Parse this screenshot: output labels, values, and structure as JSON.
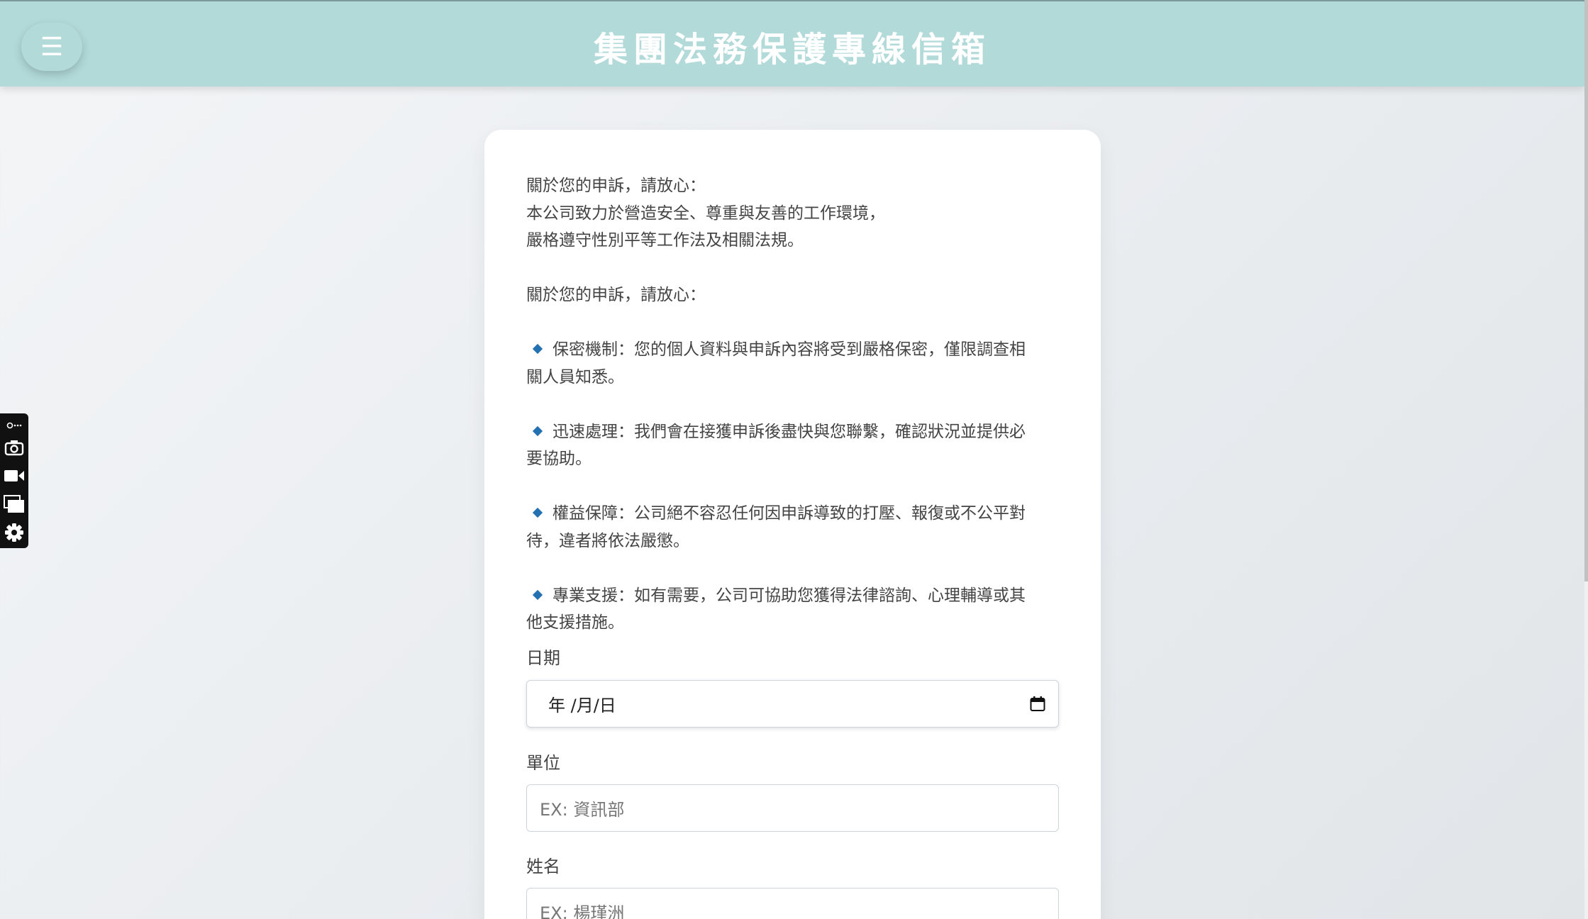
{
  "header": {
    "title": "集團法務保護專線信箱",
    "menu_icon": "☰"
  },
  "notice": {
    "intro_line1": "關於您的申訴，請放心：",
    "intro_line2": "本公司致力於營造安全、尊重與友善的工作環境，",
    "intro_line3": "嚴格遵守性別平等工作法及相關法規。",
    "heading": "關於您的申訴，請放心：",
    "bullets": [
      {
        "line1": "保密機制：您的個人資料與申訴內容將受到嚴格保密，僅限調查相",
        "line2": "關人員知悉。"
      },
      {
        "line1": "迅速處理：我們會在接獲申訴後盡快與您聯繫，確認狀況並提供必",
        "line2": "要協助。"
      },
      {
        "line1": "權益保障：公司絕不容忍任何因申訴導致的打壓、報復或不公平對",
        "line2": "待，違者將依法嚴懲。"
      },
      {
        "line1": "專業支援：如有需要，公司可協助您獲得法律諮詢、心理輔導或其",
        "line2": "他支援措施。"
      }
    ]
  },
  "form": {
    "date_label": "日期",
    "date_value": "年 /月/日",
    "unit_label": "單位",
    "unit_placeholder": "EX: 資訊部",
    "name_label": "姓名",
    "name_placeholder": "EX: 楊瑾洲"
  },
  "colors": {
    "header_bg": "#b2dad9",
    "bullet": "#2371b1"
  },
  "icons": [
    "menu-icon",
    "record-icon",
    "camera-icon",
    "video-icon",
    "windows-icon",
    "settings-icon",
    "calendar-icon"
  ]
}
